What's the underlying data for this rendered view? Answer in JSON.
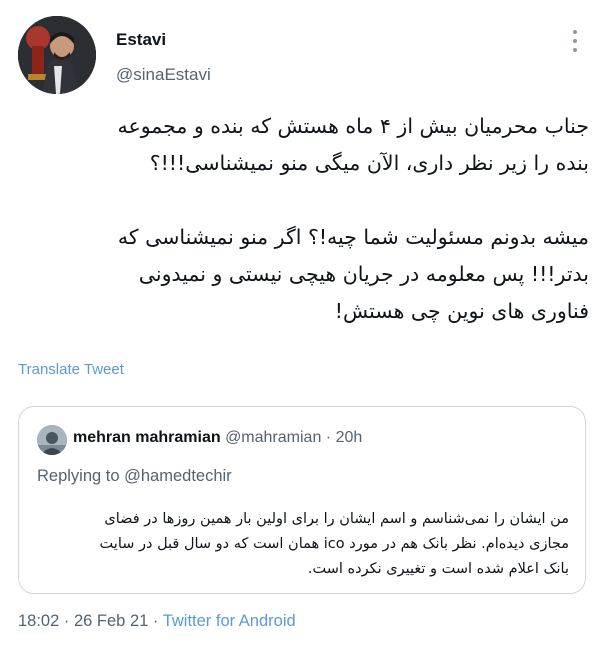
{
  "author": {
    "display_name": "Estavi",
    "handle": "@sinaEstavi",
    "avatar_icon": "profile-photo"
  },
  "tweet": {
    "text": "جناب محرمیان بیش از ۴ ماه هستش که بنده و مجموعه\nبنده را زیر نظر داری، الآن میگی منو نمیشناسی!!!؟\n\nمیشه بدونم مسئولیت شما چیه!؟ اگر منو نمیشناسی که\nبدتر!!! پس معلومه در جریان هیچی نیستی و نمیدونی\nفناوری های نوین چی هستش!",
    "translate_label": "Translate Tweet"
  },
  "quoted_tweet": {
    "display_name": "mehran mahramian",
    "handle": "@mahramian",
    "separator": "·",
    "time": "20h",
    "replying_to": "Replying to @hamedtechir",
    "text": "من ایشان را نمی‌شناسم و اسم ایشان را برای اولین بار همین روزها در فضای\nمجازی دیده‌ام. نظر بانک هم در مورد ico همان است که دو سال قبل در سایت\nبانک اعلام شده است و تغییری نکرده است."
  },
  "footer": {
    "time": "18:02",
    "separator": "·",
    "date": "26 Feb 21",
    "source": "Twitter for Android"
  },
  "colors": {
    "link": "#5a9bd4",
    "secondary_text": "#536471",
    "border": "#cfd9de"
  }
}
